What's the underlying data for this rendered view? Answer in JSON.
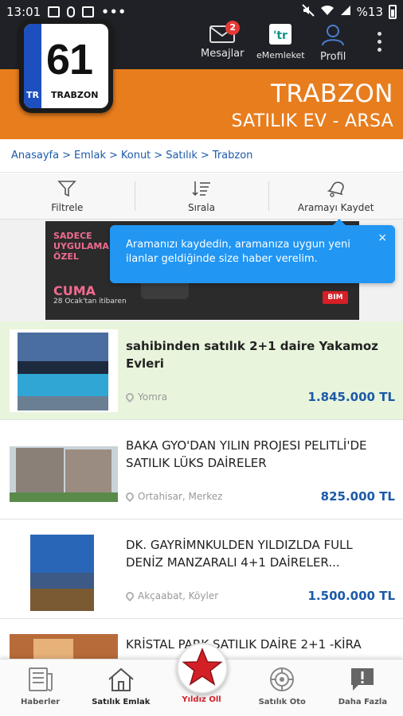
{
  "status_bar": {
    "time": "13:01",
    "battery": "%13",
    "more": "•••"
  },
  "header": {
    "messages_label": "Mesajlar",
    "messages_badge": "2",
    "ememleket_label": "eMemleket",
    "profile_label": "Profil",
    "city_title": "TRABZON",
    "city_subtitle": "SATILIK EV - ARSA",
    "plate_number": "61",
    "plate_country": "TR",
    "plate_name": "TRABZON"
  },
  "breadcrumb": [
    "Anasayfa",
    "Emlak",
    "Konut",
    "Satılık",
    "Trabzon"
  ],
  "toolbar": {
    "filter_label": "Filtrele",
    "sort_label": "Sırala",
    "save_search_label": "Aramayı Kaydet"
  },
  "ad": {
    "line1": "SADECE UYGULAMA ÖZEL",
    "line2": "CUMA",
    "line3": "28 Ocak'tan itibaren",
    "brand": "BIM"
  },
  "tooltip": {
    "text": "Aramanızı kaydedin, aramanıza uygun yeni ilanlar geldiğinde size haber verelim.",
    "close": "×"
  },
  "listings": [
    {
      "title": "sahibinden satılık 2+1 daire Yakamoz Evleri",
      "location": "Yomra",
      "price": "1.845.000 TL",
      "highlighted": true
    },
    {
      "title": "BAKA GYO'DAN YILIN PROJESI PELITLİ'DE SATILIK LÜKS DAİRELER",
      "location": "Ortahisar,  Merkez",
      "price": "825.000 TL",
      "highlighted": false
    },
    {
      "title": "DK. GAYRİMNKULDEN YILDIZLDA FULL DENİZ MANZARALI 4+1 DAİRELER...",
      "location": "Akçaabat,  Köyler",
      "price": "1.500.000 TL",
      "highlighted": false
    },
    {
      "title": "KRİSTAL PARK SATILIK DAİRE 2+1 -KİRA",
      "location": "",
      "price": "",
      "highlighted": false
    }
  ],
  "bottom_nav": {
    "news": "Haberler",
    "real_estate": "Satılık Emlak",
    "star": "Yıldız Oll",
    "cars": "Satılık Oto",
    "more": "Daha Fazla"
  },
  "colors": {
    "orange": "#e87d1e",
    "dark": "#1f2126",
    "link_blue": "#1c5aa8",
    "tooltip_blue": "#2196f3",
    "highlight_green": "#e8f5dc",
    "star_red": "#d32027"
  }
}
